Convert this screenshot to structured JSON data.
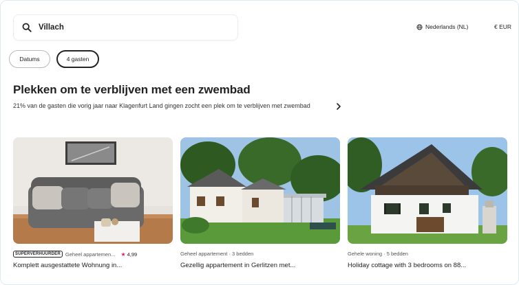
{
  "search": {
    "query": "Villach"
  },
  "header": {
    "language": "Nederlands (NL)",
    "currency": "€ EUR"
  },
  "filters": {
    "dates_label": "Datums",
    "guests_label": "4 gasten"
  },
  "section": {
    "title": "Plekken om te verblijven met een zwembad",
    "subtitle": "21% van de gasten die vorig jaar naar Klagenfurt Land gingen zocht een plek om te verblijven met zwembad"
  },
  "listings": [
    {
      "badge": "SUPERVERHUURDER",
      "type": "Geheel appartemen...",
      "rating": "4,99",
      "title": "Komplett ausgestattete Wohnung in..."
    },
    {
      "type": "Geheel appartement · 3 bedden",
      "title": "Gezellig appartement in Gerlitzen met..."
    },
    {
      "type": "Gehele woning · 5 bedden",
      "title": "Holiday cottage with 3 bedrooms on 88..."
    }
  ],
  "colors": {
    "accent_star": "#e31c5f",
    "text": "#222222"
  }
}
